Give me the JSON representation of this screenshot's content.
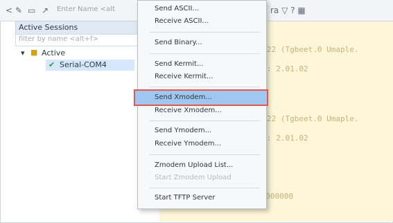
{
  "toolbar": {
    "icons": [
      "back-icon",
      "pin-icon",
      "window-icon",
      "plug-icon"
    ],
    "search_placeholder": "Enter Name <alt",
    "right_icons": [
      "columns-icon",
      "filter-icon",
      "help-icon",
      "grid-icon"
    ],
    "right_text": "ra ▽ ? ▦"
  },
  "sessions": {
    "header": "Active Sessions",
    "filter_placeholder": "filter by name <alt+f>",
    "active_label": "Active",
    "session_name": "Serial-COM4"
  },
  "menu": {
    "items": [
      {
        "label": "Send ASCII...",
        "enabled": true
      },
      {
        "label": "Receive ASCII...",
        "enabled": true
      },
      {
        "label": "Send Binary...",
        "enabled": true
      },
      {
        "label": "Send Kermit...",
        "enabled": true
      },
      {
        "label": "Receive Kermit...",
        "enabled": true
      },
      {
        "label": "Send Xmodem...",
        "enabled": true,
        "highlighted": true
      },
      {
        "label": "Receive Xmodem...",
        "enabled": true
      },
      {
        "label": "Send Ymodem...",
        "enabled": true
      },
      {
        "label": "Receive Ymodem...",
        "enabled": true
      },
      {
        "label": "Zmodem Upload List...",
        "enabled": true
      },
      {
        "label": "Start Zmodem Upload",
        "enabled": false
      },
      {
        "label": "Start TFTP Server",
        "enabled": true
      }
    ]
  },
  "terminal": {
    "lines": [
      "22 (Tgbeet.0 Umaple.",
      ": 2.01.02",
      "22 (Tgbeet.0 Umaple.",
      ": 2.01.02",
      "00000000"
    ]
  }
}
